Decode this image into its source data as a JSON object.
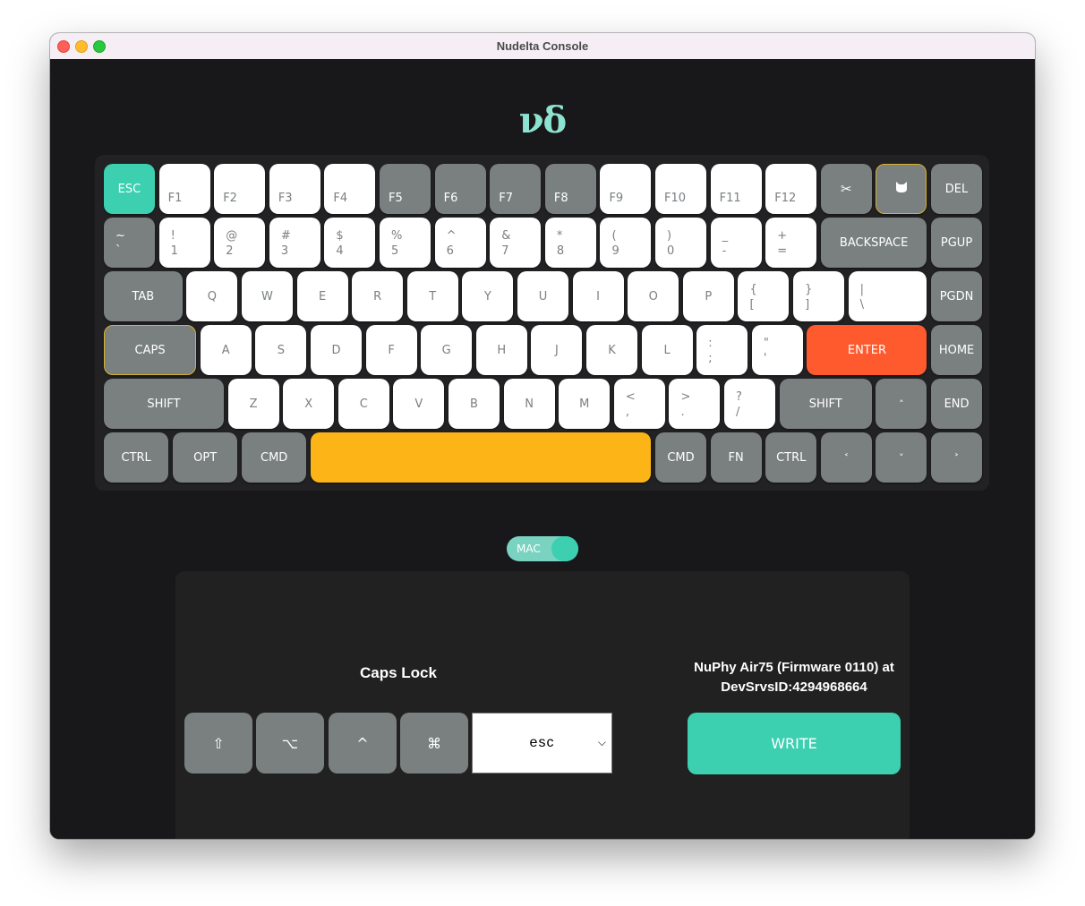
{
  "window": {
    "title": "Nudelta Console"
  },
  "logo": "νδ",
  "keyboard": {
    "rows": [
      [
        {
          "id": "esc",
          "label": "ESC",
          "style": "esc",
          "span": 4
        },
        {
          "id": "f1",
          "label": "F1",
          "style": "fn",
          "span": 4
        },
        {
          "id": "f2",
          "label": "F2",
          "style": "fn",
          "span": 4
        },
        {
          "id": "f3",
          "label": "F3",
          "style": "fn",
          "span": 4
        },
        {
          "id": "f4",
          "label": "F4",
          "style": "fn",
          "span": 4
        },
        {
          "id": "f5",
          "label": "F5",
          "style": "fnmod",
          "span": 4
        },
        {
          "id": "f6",
          "label": "F6",
          "style": "fnmod",
          "span": 4
        },
        {
          "id": "f7",
          "label": "F7",
          "style": "fnmod",
          "span": 4
        },
        {
          "id": "f8",
          "label": "F8",
          "style": "fnmod",
          "span": 4
        },
        {
          "id": "f9",
          "label": "F9",
          "style": "fn",
          "span": 4
        },
        {
          "id": "f10",
          "label": "F10",
          "style": "fn",
          "span": 4
        },
        {
          "id": "f11",
          "label": "F11",
          "style": "fn",
          "span": 4
        },
        {
          "id": "f12",
          "label": "F12",
          "style": "fn",
          "span": 4
        },
        {
          "id": "screenshot",
          "label": "✂",
          "style": "modglyph",
          "icon": "scissors-icon",
          "span": 4
        },
        {
          "id": "siri",
          "label": "🐱",
          "style": "modglyph",
          "icon": "cat-icon",
          "highlight": true,
          "span": 4
        },
        {
          "id": "del",
          "label": "DEL",
          "style": "mod",
          "span": 4
        }
      ],
      [
        {
          "id": "grave",
          "top": "~",
          "bottom": "`",
          "style": "dualmod",
          "span": 4
        },
        {
          "id": "1",
          "top": "!",
          "bottom": "1",
          "style": "dual",
          "span": 4
        },
        {
          "id": "2",
          "top": "@",
          "bottom": "2",
          "style": "dual",
          "span": 4
        },
        {
          "id": "3",
          "top": "#",
          "bottom": "3",
          "style": "dual",
          "span": 4
        },
        {
          "id": "4",
          "top": "$",
          "bottom": "4",
          "style": "dual",
          "span": 4
        },
        {
          "id": "5",
          "top": "%",
          "bottom": "5",
          "style": "dual",
          "span": 4
        },
        {
          "id": "6",
          "top": "^",
          "bottom": "6",
          "style": "dual",
          "span": 4
        },
        {
          "id": "7",
          "top": "&",
          "bottom": "7",
          "style": "dual",
          "span": 4
        },
        {
          "id": "8",
          "top": "*",
          "bottom": "8",
          "style": "dual",
          "span": 4
        },
        {
          "id": "9",
          "top": "(",
          "bottom": "9",
          "style": "dual",
          "span": 4
        },
        {
          "id": "0",
          "top": ")",
          "bottom": "0",
          "style": "dual",
          "span": 4
        },
        {
          "id": "minus",
          "top": "_",
          "bottom": "-",
          "style": "dual",
          "span": 4
        },
        {
          "id": "equal",
          "top": "+",
          "bottom": "=",
          "style": "dual",
          "span": 4
        },
        {
          "id": "backspace",
          "label": "BACKSPACE",
          "style": "mod",
          "span": 8
        },
        {
          "id": "pgup",
          "label": "PGUP",
          "style": "mod",
          "span": 4
        }
      ],
      [
        {
          "id": "tab",
          "label": "TAB",
          "style": "mod",
          "span": 6
        },
        {
          "id": "q",
          "label": "Q",
          "style": "alpha",
          "span": 4
        },
        {
          "id": "w",
          "label": "W",
          "style": "alpha",
          "span": 4
        },
        {
          "id": "e",
          "label": "E",
          "style": "alpha",
          "span": 4
        },
        {
          "id": "r",
          "label": "R",
          "style": "alpha",
          "span": 4
        },
        {
          "id": "t",
          "label": "T",
          "style": "alpha",
          "span": 4
        },
        {
          "id": "y",
          "label": "Y",
          "style": "alpha",
          "span": 4
        },
        {
          "id": "u",
          "label": "U",
          "style": "alpha",
          "span": 4
        },
        {
          "id": "i",
          "label": "I",
          "style": "alpha",
          "span": 4
        },
        {
          "id": "o",
          "label": "O",
          "style": "alpha",
          "span": 4
        },
        {
          "id": "p",
          "label": "P",
          "style": "alpha",
          "span": 4
        },
        {
          "id": "lbracket",
          "top": "{",
          "bottom": "[",
          "style": "dual",
          "span": 4
        },
        {
          "id": "rbracket",
          "top": "}",
          "bottom": "]",
          "style": "dual",
          "span": 4
        },
        {
          "id": "backslash",
          "top": "|",
          "bottom": "\\",
          "style": "dual",
          "span": 6
        },
        {
          "id": "pgdn",
          "label": "PGDN",
          "style": "mod",
          "span": 4
        }
      ],
      [
        {
          "id": "caps",
          "label": "CAPS",
          "style": "mod",
          "highlight": true,
          "span": 7
        },
        {
          "id": "a",
          "label": "A",
          "style": "alpha",
          "span": 4
        },
        {
          "id": "s",
          "label": "S",
          "style": "alpha",
          "span": 4
        },
        {
          "id": "d",
          "label": "D",
          "style": "alpha",
          "span": 4
        },
        {
          "id": "f",
          "label": "F",
          "style": "alpha",
          "span": 4
        },
        {
          "id": "g",
          "label": "G",
          "style": "alpha",
          "span": 4
        },
        {
          "id": "h",
          "label": "H",
          "style": "alpha",
          "span": 4
        },
        {
          "id": "j",
          "label": "J",
          "style": "alpha",
          "span": 4
        },
        {
          "id": "k",
          "label": "K",
          "style": "alpha",
          "span": 4
        },
        {
          "id": "l",
          "label": "L",
          "style": "alpha",
          "span": 4
        },
        {
          "id": "semicolon",
          "top": ":",
          "bottom": ";",
          "style": "dual",
          "span": 4
        },
        {
          "id": "quote",
          "top": "\"",
          "bottom": "'",
          "style": "dual",
          "span": 4
        },
        {
          "id": "enter",
          "label": "ENTER",
          "style": "enter",
          "span": 9
        },
        {
          "id": "home",
          "label": "HOME",
          "style": "mod",
          "span": 4
        }
      ],
      [
        {
          "id": "lshift",
          "label": "SHIFT",
          "style": "mod",
          "span": 9
        },
        {
          "id": "z",
          "label": "Z",
          "style": "alpha",
          "span": 4
        },
        {
          "id": "x",
          "label": "X",
          "style": "alpha",
          "span": 4
        },
        {
          "id": "c",
          "label": "C",
          "style": "alpha",
          "span": 4
        },
        {
          "id": "v",
          "label": "V",
          "style": "alpha",
          "span": 4
        },
        {
          "id": "b",
          "label": "B",
          "style": "alpha",
          "span": 4
        },
        {
          "id": "n",
          "label": "N",
          "style": "alpha",
          "span": 4
        },
        {
          "id": "m",
          "label": "M",
          "style": "alpha",
          "span": 4
        },
        {
          "id": "comma",
          "top": "<",
          "bottom": ",",
          "style": "dual",
          "span": 4
        },
        {
          "id": "period",
          "top": ">",
          "bottom": ".",
          "style": "dual",
          "span": 4
        },
        {
          "id": "slash",
          "top": "?",
          "bottom": "/",
          "style": "dual",
          "span": 4
        },
        {
          "id": "rshift",
          "label": "SHIFT",
          "style": "mod",
          "span": 7
        },
        {
          "id": "up",
          "label": "˄",
          "style": "modsmall",
          "span": 4
        },
        {
          "id": "end",
          "label": "END",
          "style": "mod",
          "span": 4
        }
      ],
      [
        {
          "id": "lctrl",
          "label": "CTRL",
          "style": "mod",
          "span": 5
        },
        {
          "id": "lopt",
          "label": "OPT",
          "style": "mod",
          "span": 5
        },
        {
          "id": "lcmd",
          "label": "CMD",
          "style": "mod",
          "span": 5
        },
        {
          "id": "space",
          "label": "",
          "style": "space",
          "span": 25
        },
        {
          "id": "rcmd",
          "label": "CMD",
          "style": "mod",
          "span": 4
        },
        {
          "id": "fn",
          "label": "FN",
          "style": "mod",
          "span": 4
        },
        {
          "id": "rctrl",
          "label": "CTRL",
          "style": "mod",
          "span": 4
        },
        {
          "id": "left",
          "label": "˂",
          "style": "modsmall",
          "span": 4
        },
        {
          "id": "down",
          "label": "˅",
          "style": "modsmall",
          "span": 4
        },
        {
          "id": "right",
          "label": "˃",
          "style": "modsmall",
          "span": 4
        }
      ]
    ]
  },
  "os_toggle": {
    "label": "MAC",
    "on": true
  },
  "editor": {
    "selected_key_name": "Caps Lock",
    "modifiers": [
      {
        "id": "shift",
        "glyph": "⇧",
        "icon": "shift-icon"
      },
      {
        "id": "option",
        "glyph": "⌥",
        "icon": "option-icon"
      },
      {
        "id": "control",
        "glyph": "^",
        "icon": "control-icon"
      },
      {
        "id": "command",
        "glyph": "⌘",
        "icon": "command-icon"
      }
    ],
    "key_select": {
      "value": "esc"
    }
  },
  "device": {
    "info_line1": "NuPhy Air75 (Firmware 0110) at",
    "info_line2": "DevSrvsID:4294968664"
  },
  "write_button": {
    "label": "WRITE"
  },
  "colors": {
    "accent": "#3cd0b0",
    "enter": "#ff5a2e",
    "space": "#fdb416",
    "modifier": "#7a8080",
    "highlight_border": "#d9b12a"
  }
}
